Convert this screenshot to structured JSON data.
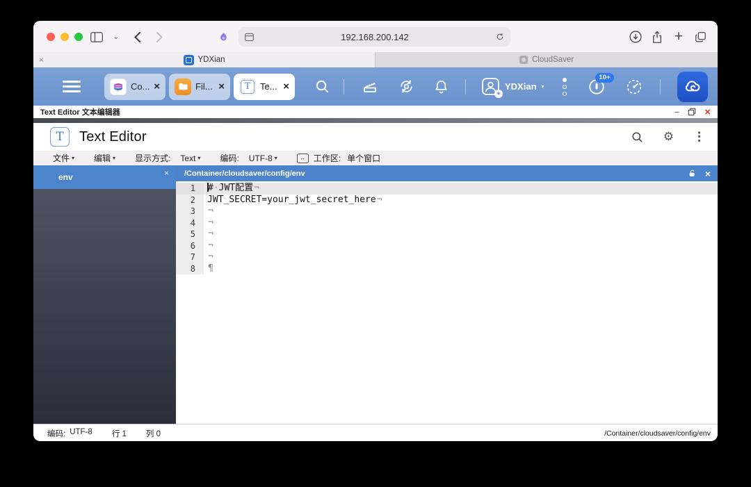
{
  "icons": {
    "close": "×",
    "minimize": "−",
    "kebab": "⋮",
    "gear": "⚙",
    "arrow_down": "▾",
    "chevron_down": "⌄",
    "plus": "+",
    "star": "★"
  },
  "browser": {
    "url": "192.168.200.142",
    "tabs": [
      {
        "label": "YDXian",
        "active": true
      },
      {
        "label": "CloudSaver",
        "active": false
      }
    ]
  },
  "app_bar": {
    "tabs": [
      {
        "label": "Co...",
        "icon": "container-manager-icon"
      },
      {
        "label": "Fil...",
        "icon": "files-icon"
      },
      {
        "label": "Te...",
        "icon": "text-editor-icon",
        "active": true
      }
    ],
    "user_name": "YDXian",
    "notification_badge": "10+"
  },
  "editor": {
    "window_title": "Text Editor 文本编辑器",
    "app_title": "Text Editor",
    "menubar": {
      "file": "文件",
      "edit": "编辑",
      "view_label": "显示方式:",
      "view_value": "Text",
      "encoding_label": "编码:",
      "encoding_value": "UTF-8",
      "workspace_label": "工作区:",
      "workspace_value": "单个窗口"
    },
    "sidebar": {
      "file_tab": "env"
    },
    "file_path": "/Container/cloudsaver/config/env",
    "lines": [
      {
        "num": 1,
        "text": "# JWT配置",
        "eol": "¬",
        "current": true,
        "cursor": true
      },
      {
        "num": 2,
        "text": "JWT_SECRET=your_jwt_secret_here",
        "eol": "¬"
      },
      {
        "num": 3,
        "text": "",
        "eol": "¬"
      },
      {
        "num": 4,
        "text": "",
        "eol": "¬"
      },
      {
        "num": 5,
        "text": "",
        "eol": "¬"
      },
      {
        "num": 6,
        "text": "",
        "eol": "¬"
      },
      {
        "num": 7,
        "text": "",
        "eol": "¬"
      },
      {
        "num": 8,
        "text": "",
        "eol": "¶"
      }
    ],
    "statusbar": {
      "encoding_label": "编码:",
      "encoding": "UTF-8",
      "line": "行 1",
      "column": "列 0",
      "path": "/Container/cloudsaver/config/env"
    }
  },
  "colors": {
    "app_bar_blue": "#6b92cc",
    "file_tab_blue": "#4d85cc",
    "cloud_tile_blue": "#2f6ae0",
    "close_red": "#d93b30"
  }
}
